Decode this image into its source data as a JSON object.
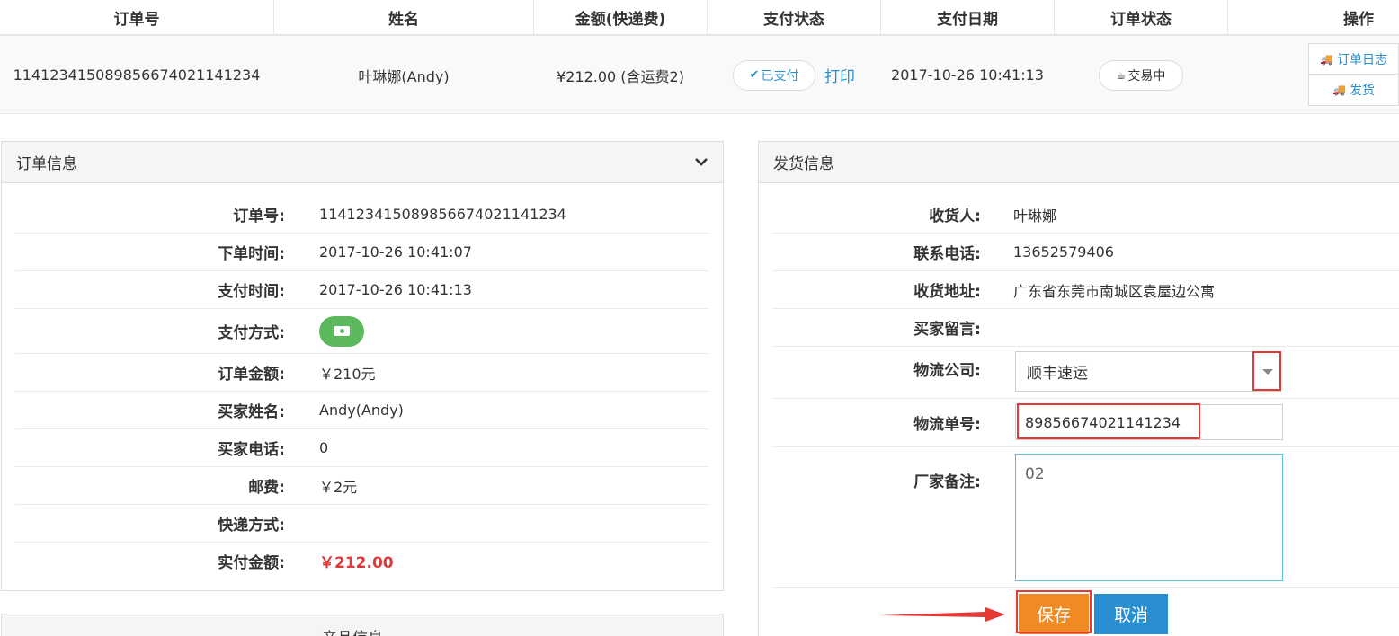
{
  "table": {
    "headers": [
      "订单号",
      "姓名",
      "金额(快递费)",
      "支付状态",
      "支付日期",
      "订单状态",
      "操作"
    ],
    "row": {
      "order_no": "114123415089856674021141234",
      "name": "叶琳娜(Andy)",
      "amount": "¥212.00 (含运费2)",
      "pay_status": "已支付",
      "print": "打印",
      "pay_date": "2017-10-26 10:41:13",
      "order_status": "交易中",
      "ops": [
        "订单日志",
        "发货"
      ]
    }
  },
  "order_panel": {
    "title": "订单信息",
    "rows": [
      {
        "label": "订单号:",
        "value": "114123415089856674021141234"
      },
      {
        "label": "下单时间:",
        "value": "2017-10-26 10:41:07"
      },
      {
        "label": "支付时间:",
        "value": "2017-10-26 10:41:13"
      },
      {
        "label": "支付方式:",
        "value": ""
      },
      {
        "label": "订单金额:",
        "value": "￥210元"
      },
      {
        "label": "买家姓名:",
        "value": "Andy(Andy)"
      },
      {
        "label": "买家电话:",
        "value": "0"
      },
      {
        "label": "邮费:",
        "value": "￥2元"
      },
      {
        "label": "快递方式:",
        "value": ""
      },
      {
        "label": "实付金额:",
        "value": "￥212.00"
      }
    ]
  },
  "ship_panel": {
    "title": "发货信息",
    "rows": [
      {
        "label": "收货人:",
        "value": "叶琳娜"
      },
      {
        "label": "联系电话:",
        "value": "13652579406"
      },
      {
        "label": "收货地址:",
        "value": "广东省东莞市南城区袁屋边公寓"
      },
      {
        "label": "买家留言:",
        "value": ""
      }
    ],
    "logistics_label": "物流公司:",
    "logistics_value": "顺丰速运",
    "tracking_label": "物流单号:",
    "tracking_value": "89856674021141234",
    "remark_label": "厂家备注:",
    "remark_value": "02",
    "save": "保存",
    "cancel": "取消"
  },
  "product_panel": {
    "title": "产品信息"
  },
  "colors": {
    "link_blue": "#2a8fd0",
    "save_orange": "#f08a24",
    "pay_green": "#5cb85c",
    "highlight_red": "#e53935",
    "total_red": "#e03b3b"
  }
}
